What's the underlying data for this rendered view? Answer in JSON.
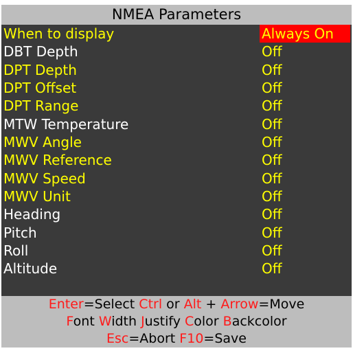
{
  "title": "NMEA Parameters",
  "colors": {
    "panel_bg": "#3a3a3a",
    "bar_bg": "#bdbdbd",
    "label_yellow": "#ffff00",
    "label_white": "#ffffff",
    "value_yellow": "#ffff00",
    "selected_bg": "#ff0000",
    "key_red": "#ff1a1a"
  },
  "rows": [
    {
      "label": "When to display",
      "value": "Always On",
      "label_color": "yellow",
      "value_color": "yellow",
      "selected": true
    },
    {
      "label": "DBT Depth",
      "value": "Off",
      "label_color": "white",
      "value_color": "yellow",
      "selected": false
    },
    {
      "label": "DPT Depth",
      "value": "Off",
      "label_color": "yellow",
      "value_color": "yellow",
      "selected": false
    },
    {
      "label": "DPT Offset",
      "value": "Off",
      "label_color": "yellow",
      "value_color": "yellow",
      "selected": false
    },
    {
      "label": "DPT Range",
      "value": "Off",
      "label_color": "yellow",
      "value_color": "yellow",
      "selected": false
    },
    {
      "label": "MTW Temperature",
      "value": "Off",
      "label_color": "white",
      "value_color": "yellow",
      "selected": false
    },
    {
      "label": "MWV Angle",
      "value": "Off",
      "label_color": "yellow",
      "value_color": "yellow",
      "selected": false
    },
    {
      "label": "MWV Reference",
      "value": "Off",
      "label_color": "yellow",
      "value_color": "yellow",
      "selected": false
    },
    {
      "label": "MWV Speed",
      "value": "Off",
      "label_color": "yellow",
      "value_color": "yellow",
      "selected": false
    },
    {
      "label": "MWV Unit",
      "value": "Off",
      "label_color": "yellow",
      "value_color": "yellow",
      "selected": false
    },
    {
      "label": "Heading",
      "value": "Off",
      "label_color": "white",
      "value_color": "yellow",
      "selected": false
    },
    {
      "label": "Pitch",
      "value": "Off",
      "label_color": "white",
      "value_color": "yellow",
      "selected": false
    },
    {
      "label": "Roll",
      "value": "Off",
      "label_color": "white",
      "value_color": "yellow",
      "selected": false
    },
    {
      "label": "Altitude",
      "value": "Off",
      "label_color": "white",
      "value_color": "yellow",
      "selected": false
    }
  ],
  "footer": {
    "line1": {
      "enter_key": "Enter",
      "enter_text": "=Select ",
      "ctrl_key": "Ctrl",
      "or_text": " or ",
      "alt_key": "Alt",
      "plus_text": " + ",
      "arrow_key": "Arrow",
      "move_text": "=Move"
    },
    "line2": {
      "f_key": "F",
      "f_rest": "ont ",
      "w_key": "W",
      "w_rest": "idth ",
      "j_key": "J",
      "j_rest": "ustify ",
      "c_key": "C",
      "c_rest": "olor ",
      "b_key": "B",
      "b_rest": "ackcolor"
    },
    "line3": {
      "esc_key": "Esc",
      "abort_text": "=Abort ",
      "f10_key": "F10",
      "save_text": "=Save"
    }
  }
}
